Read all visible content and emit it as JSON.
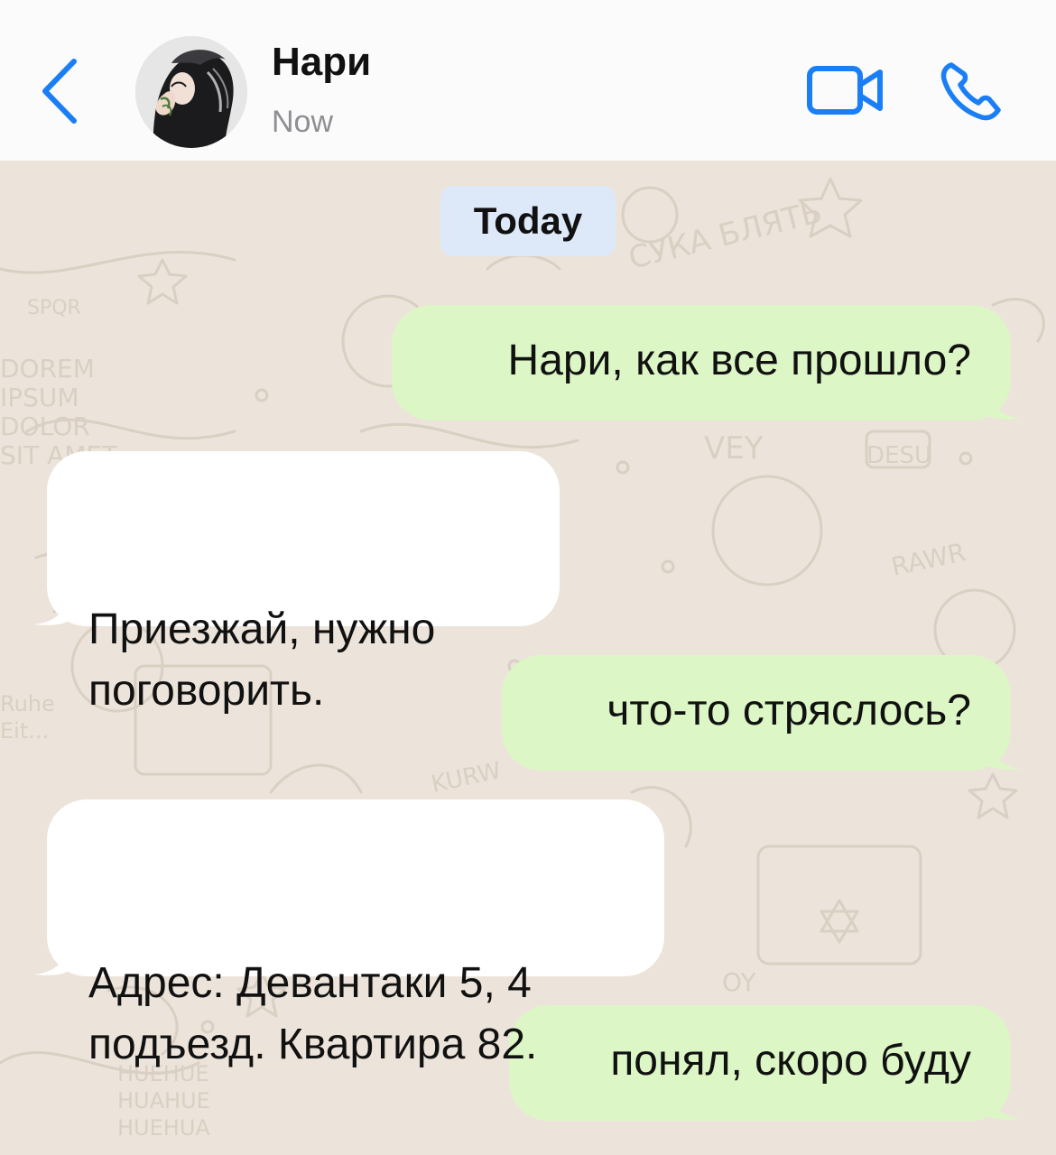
{
  "header": {
    "contact_name": "Нари",
    "status": "Now",
    "accent": "#1a7ef6"
  },
  "date_divider": "Today",
  "messages": [
    {
      "direction": "outgoing",
      "text": "Нари, как все прошло?"
    },
    {
      "direction": "incoming",
      "text": "Приезжай, нужно\nпоговорить."
    },
    {
      "direction": "outgoing",
      "text": "что-то стряслось?"
    },
    {
      "direction": "incoming",
      "text": "Адрес: Девантаки 5, 4\nподъезд. Квартира 82."
    },
    {
      "direction": "outgoing",
      "text": "понял, скоро буду"
    }
  ],
  "wallpaper": {
    "doodles": [
      "СУКА БЛЯТЬ",
      "VEY",
      "DESU",
      "RAWR",
      "KURW",
      "OY",
      "DOREM",
      "IPSUM",
      "DOLOR",
      "SIT AMET",
      "SPQR",
      "HUEHUE",
      "HUAHUE",
      "HUEHUA",
      "Ruhe",
      "Eit..."
    ],
    "colors": {
      "background": "#ece4da",
      "ink": "#d9cfc2"
    }
  },
  "colors": {
    "outgoing_bubble": "#dcf7c5",
    "incoming_bubble": "#ffffff",
    "date_pill": "#dde8f9"
  }
}
